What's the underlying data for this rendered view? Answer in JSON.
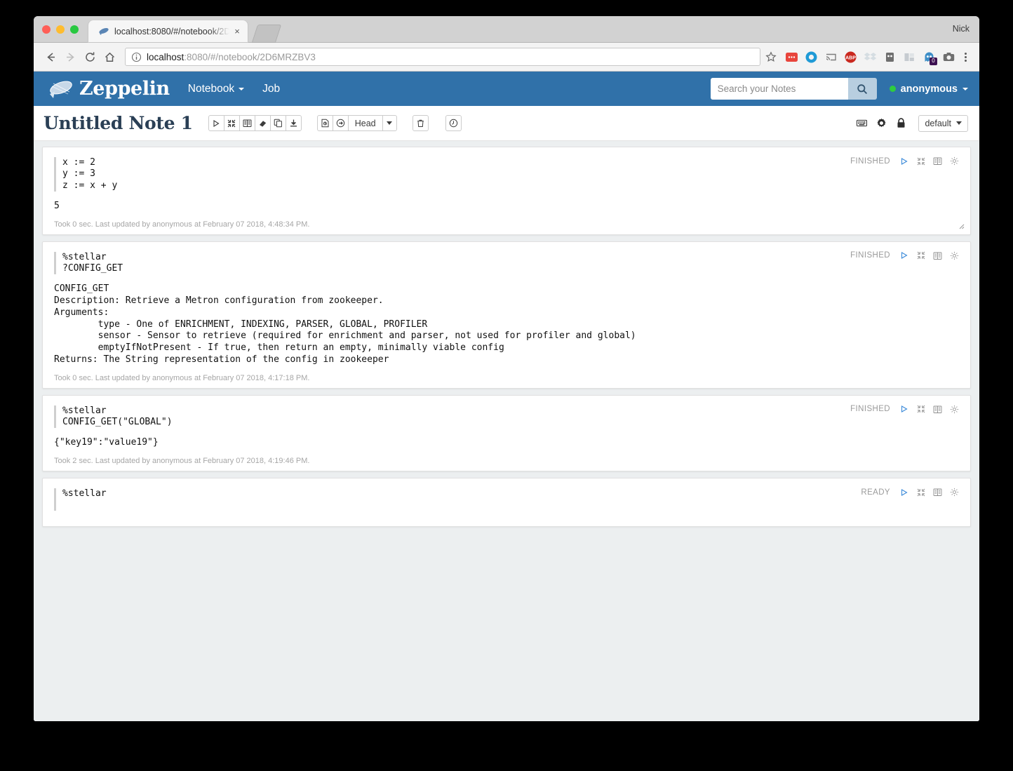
{
  "window": {
    "user_label": "Nick",
    "tab_title": "localhost:8080/#/notebook/2D",
    "tab_close": "×",
    "url_host": "localhost",
    "url_path": ":8080/#/notebook/2D6MRZBV3",
    "extensions": [
      {
        "name": "adblock-extension-icon"
      },
      {
        "name": "opera-extension-icon"
      },
      {
        "name": "cast-icon"
      },
      {
        "name": "abp-extension-icon",
        "label": "ABP"
      },
      {
        "name": "dropbox-extension-icon"
      },
      {
        "name": "lastpass-extension-icon"
      },
      {
        "name": "grid-extension-icon"
      },
      {
        "name": "ghostery-extension-icon",
        "badge": "0"
      },
      {
        "name": "screenshot-extension-icon"
      }
    ]
  },
  "navbar": {
    "brand": "Zeppelin",
    "links": [
      {
        "label": "Notebook",
        "has_caret": true
      },
      {
        "label": "Job",
        "has_caret": false
      }
    ],
    "search": {
      "placeholder": "Search your Notes",
      "value": ""
    },
    "user": "anonymous",
    "brand_color": "#3071a9",
    "status_color": "#2ecc40"
  },
  "note_toolbar": {
    "title": "Untitled Note 1",
    "run_group": [
      {
        "name": "run-all-paragraphs-button"
      },
      {
        "name": "collapse-all-button"
      },
      {
        "name": "show-hide-code-button"
      },
      {
        "name": "clear-output-button"
      },
      {
        "name": "clone-note-button"
      },
      {
        "name": "export-note-button"
      }
    ],
    "version_group": [
      {
        "name": "commit-button"
      },
      {
        "name": "set-revision-button"
      }
    ],
    "revision_label": "Head",
    "delete_button": "trash-icon",
    "schedule_button": "clock-icon",
    "right_tools": [
      {
        "name": "keyboard-shortcuts-icon"
      },
      {
        "name": "note-settings-gear-icon"
      },
      {
        "name": "note-permissions-lock-icon"
      }
    ],
    "interpreter_binding": "default"
  },
  "paragraphs": [
    {
      "code": "x := 2\ny := 3\nz := x + y",
      "result": "5",
      "footer": "Took 0 sec. Last updated by anonymous at February 07 2018, 4:48:34 PM.",
      "status": "FINISHED",
      "has_resize_handle": true
    },
    {
      "code": "%stellar\n?CONFIG_GET",
      "result": "CONFIG_GET\nDescription: Retrieve a Metron configuration from zookeeper.\nArguments:\n        type - One of ENRICHMENT, INDEXING, PARSER, GLOBAL, PROFILER\n        sensor - Sensor to retrieve (required for enrichment and parser, not used for profiler and global)\n        emptyIfNotPresent - If true, then return an empty, minimally viable config\nReturns: The String representation of the config in zookeeper",
      "footer": "Took 0 sec. Last updated by anonymous at February 07 2018, 4:17:18 PM.",
      "status": "FINISHED",
      "has_resize_handle": false
    },
    {
      "code": "%stellar\nCONFIG_GET(\"GLOBAL\")",
      "result": "{\"key19\":\"value19\"}",
      "footer": "Took 2 sec. Last updated by anonymous at February 07 2018, 4:19:46 PM.",
      "status": "FINISHED",
      "has_resize_handle": false
    },
    {
      "code": "%stellar",
      "result": "",
      "footer": "",
      "status": "READY",
      "has_resize_handle": false
    }
  ],
  "paragraph_controls": [
    {
      "name": "run-paragraph-button"
    },
    {
      "name": "collapse-paragraph-button"
    },
    {
      "name": "show-hide-paragraph-code-button"
    },
    {
      "name": "paragraph-settings-gear-icon"
    }
  ]
}
